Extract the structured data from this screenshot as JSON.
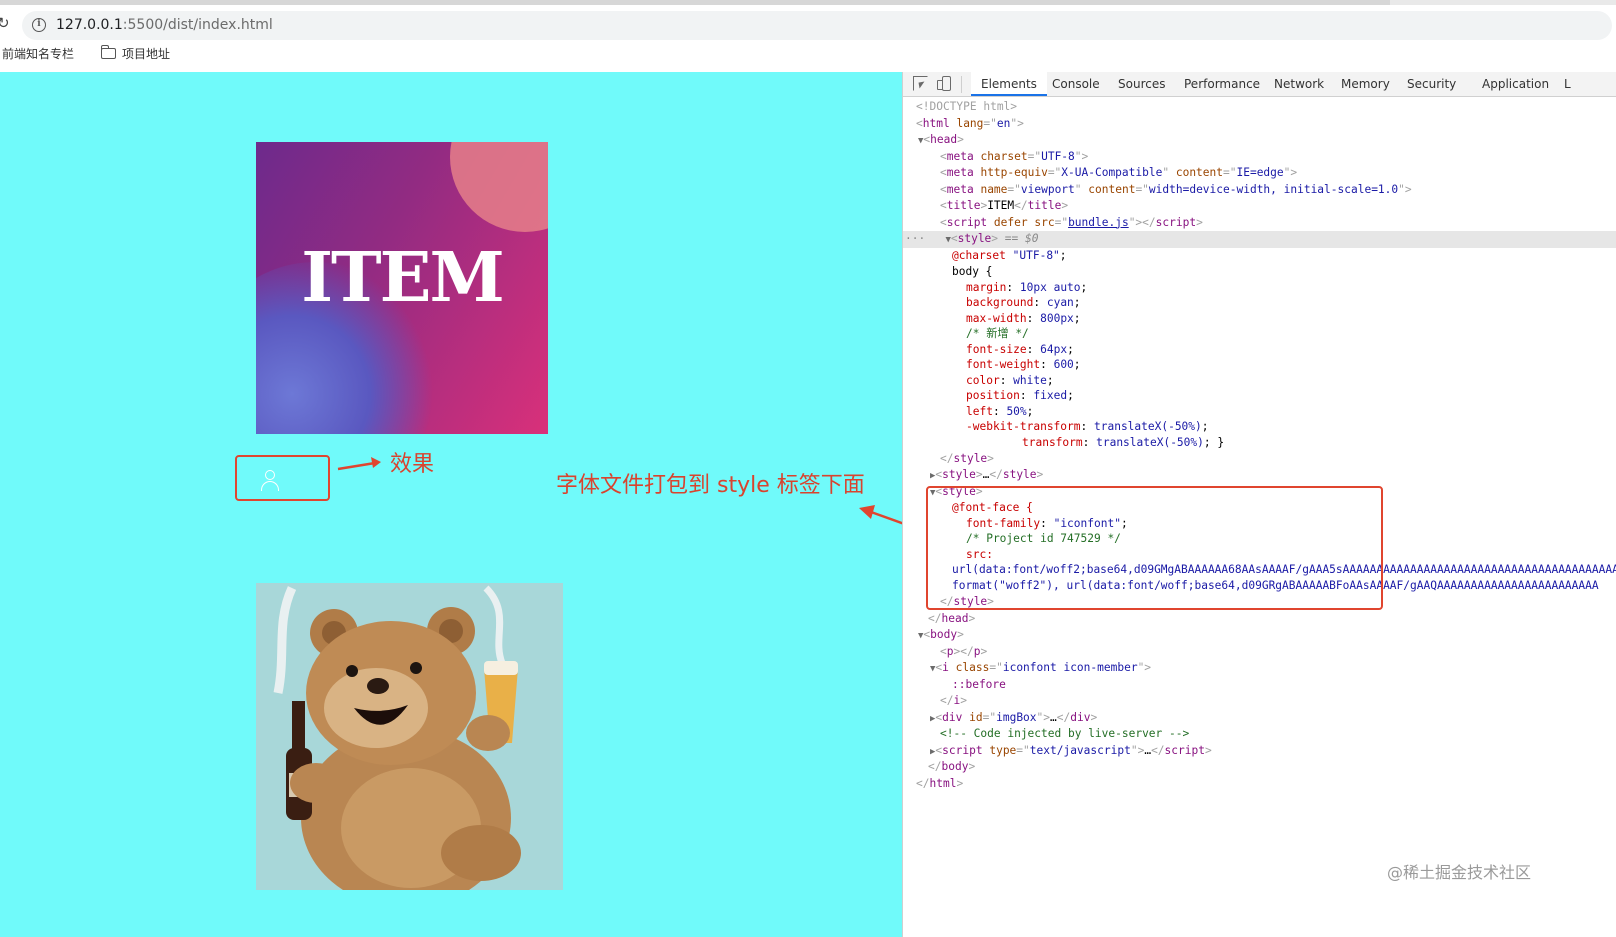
{
  "browser": {
    "url_host": "127.0.0.1",
    "url_rest": ":5500/dist/index.html",
    "bookmarks": [
      {
        "label": "前端知名专栏"
      },
      {
        "label": "项目地址"
      }
    ]
  },
  "page": {
    "background": "#70fafa",
    "image_title": "ITEM",
    "effect_label": "效果",
    "annotation": "字体文件打包到 style 标签下面"
  },
  "devtools": {
    "tabs": [
      "Elements",
      "Console",
      "Sources",
      "Performance",
      "Network",
      "Memory",
      "Security",
      "Application",
      "L"
    ],
    "active_tab": "Elements",
    "code": {
      "doctype": "<!DOCTYPE html>",
      "html_open_tag": "html",
      "html_lang_attr": "lang",
      "html_lang_val": "en",
      "head_tag": "head",
      "meta1_attr": "charset",
      "meta1_val": "UTF-8",
      "meta2_attr1": "http-equiv",
      "meta2_val1": "X-UA-Compatible",
      "meta2_attr2": "content",
      "meta2_val2": "IE=edge",
      "meta3_attr1": "name",
      "meta3_val1": "viewport",
      "meta3_attr2": "content",
      "meta3_val2": "width=device-width, initial-scale=1.0",
      "title_text": "ITEM",
      "script_attr1": "defer",
      "script_attr2": "src",
      "script_val": "bundle.js",
      "selected_marker": "== $0",
      "charset_rule": "@charset",
      "charset_val": "\"UTF-8\"",
      "body_selector": "body {",
      "props": [
        {
          "name": "margin",
          "value": "10px auto"
        },
        {
          "name": "background",
          "value": "cyan"
        },
        {
          "name": "max-width",
          "value": "800px"
        },
        {
          "comment": "/* 新增 */"
        },
        {
          "name": "font-size",
          "value": "64px"
        },
        {
          "name": "font-weight",
          "value": "600"
        },
        {
          "name": "color",
          "value": "white"
        },
        {
          "name": "position",
          "value": "fixed"
        },
        {
          "name": "left",
          "value": "50%"
        },
        {
          "name": "-webkit-transform",
          "value": "translateX(-50%)"
        }
      ],
      "transform_line_name": "transform",
      "transform_line_value": "translateX(-50%)",
      "style_collapsed": "…",
      "fontface_rule": "@font-face {",
      "fontface_family_prop": "font-family",
      "fontface_family_val": "\"iconfont\"",
      "fontface_comment": "/* Project id 747529 */",
      "fontface_src_prop": "src:",
      "fontface_url1": "url(data:font/woff2;base64,d09GMgABAAAAAA68AAsAAAAF/gAAA5sAAAAAAAAAAAAAAAAAAAAAAAAAAAAAAAAAAAAAAAAAAAA",
      "fontface_format1": "format(\"woff2\"), url(data:font/woff;base64,d09GRgABAAAAABFoAAsAAAAF/gAAQAAAAAAAAAAAAAAAAAAAAAAAA",
      "p_tag": "p",
      "i_tag": "i",
      "i_class_attr": "class",
      "i_class_val": "iconfont icon-member",
      "before_pseudo": "::before",
      "div_tag": "div",
      "div_id_attr": "id",
      "div_id_val": "imgBox",
      "comment_live": "<!-- Code injected by live-server -->",
      "script2_attr": "type",
      "script2_val": "text/javascript",
      "ellipsis": "…"
    }
  },
  "watermark": "@稀土掘金技术社区",
  "colors": {
    "annotation_red": "#e0452f",
    "devtools_tab_accent": "#1a73e8",
    "tag_purple": "#881280",
    "attr_orange": "#994500",
    "value_blue": "#1a1aa6"
  },
  "icons": [
    "reload-icon",
    "info-icon",
    "folder-icon",
    "user-icon",
    "inspect-icon",
    "device-toolbar-icon",
    "expand-triangle-icon"
  ]
}
